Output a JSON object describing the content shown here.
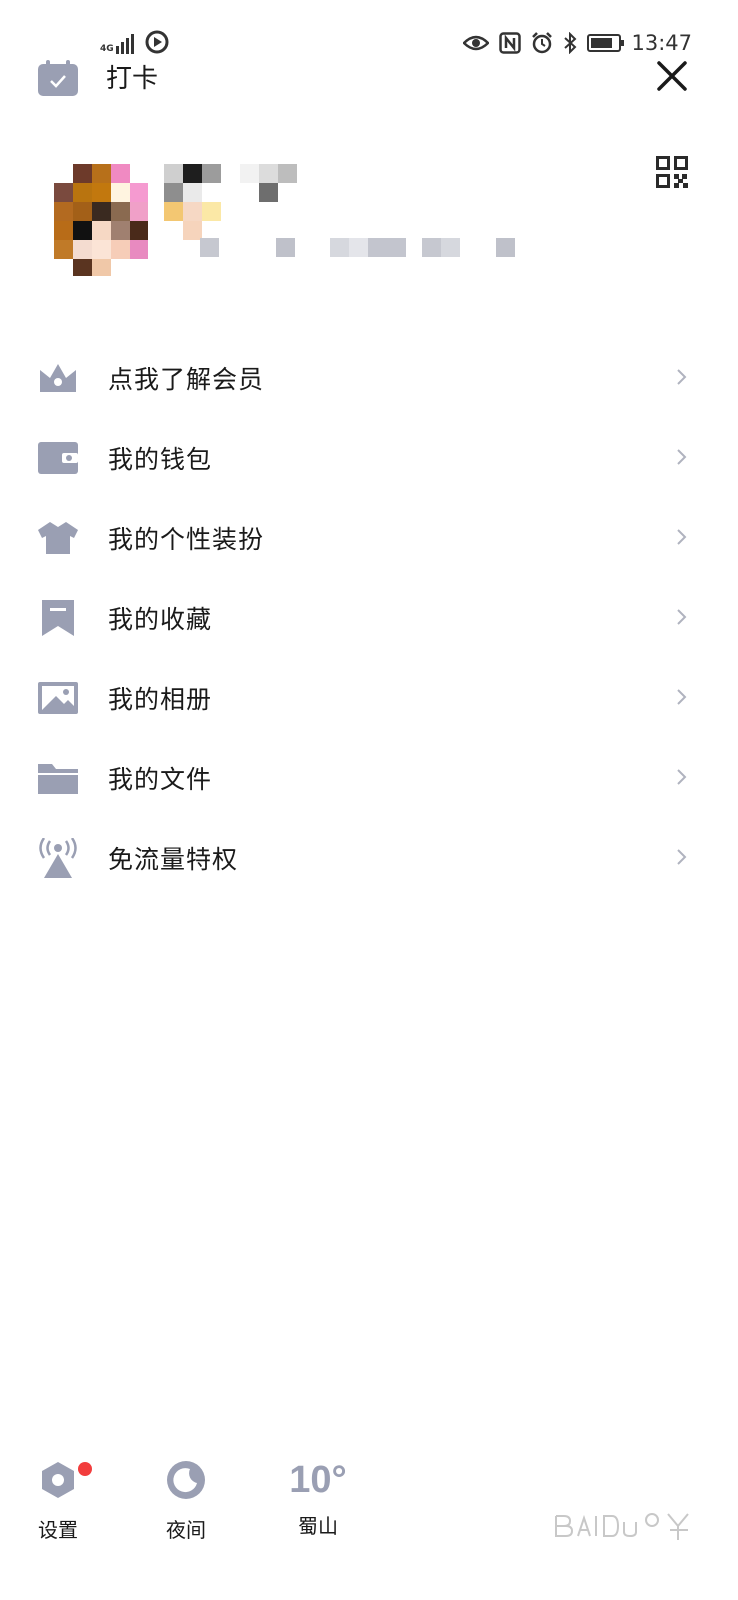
{
  "status_bar": {
    "network": "4G",
    "time": "13:47",
    "battery_level": 0.8
  },
  "top_bar": {
    "checkin_label": "打卡"
  },
  "menu": {
    "items": [
      {
        "label": "点我了解会员",
        "icon": "crown-icon"
      },
      {
        "label": "我的钱包",
        "icon": "wallet-icon"
      },
      {
        "label": "我的个性装扮",
        "icon": "tshirt-icon"
      },
      {
        "label": "我的收藏",
        "icon": "bookmark-icon"
      },
      {
        "label": "我的相册",
        "icon": "photo-icon"
      },
      {
        "label": "我的文件",
        "icon": "folder-icon"
      },
      {
        "label": "免流量特权",
        "icon": "broadcast-tower-icon"
      }
    ]
  },
  "bottom_bar": {
    "settings_label": "设置",
    "night_label": "夜间",
    "weather_temp": "10°",
    "weather_location": "蜀山"
  },
  "colors": {
    "icon_gray": "#9a9fb3",
    "badge_red": "#f23d3d",
    "text": "#1a1a1a"
  }
}
